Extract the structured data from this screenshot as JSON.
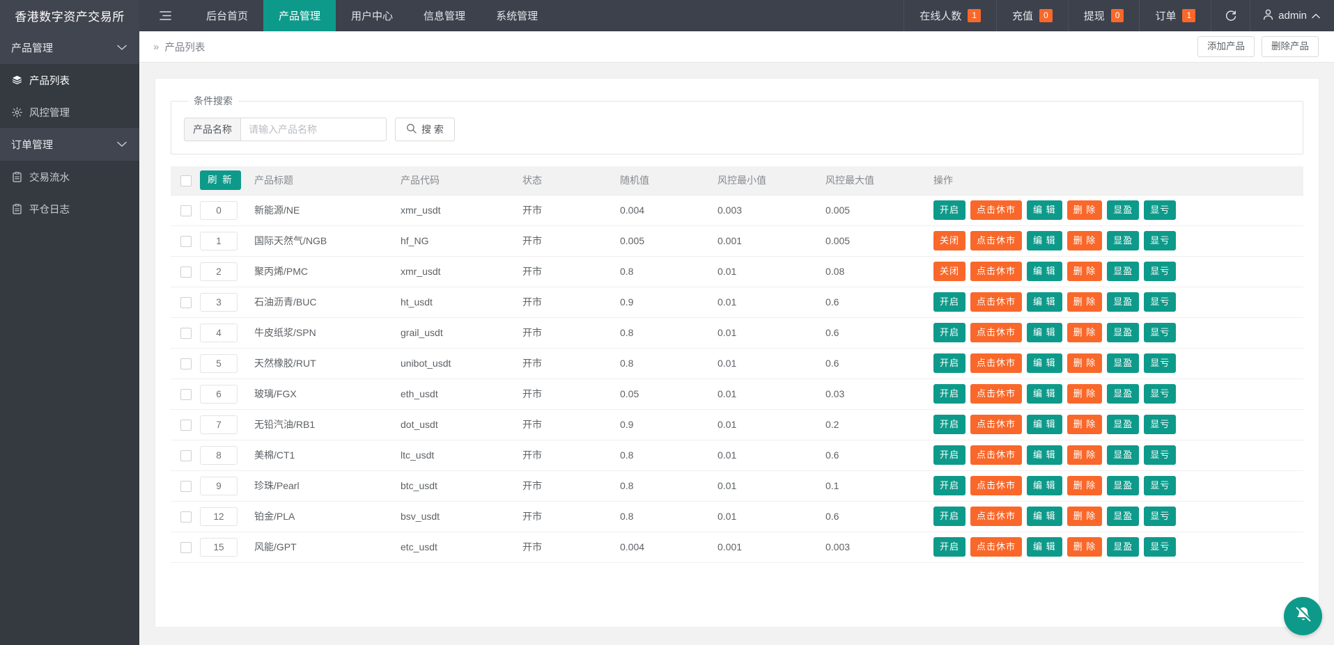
{
  "header": {
    "brand": "香港数字资产交易所",
    "hamburger_icon": "hamburger-icon",
    "nav": [
      {
        "label": "后台首页",
        "active": false
      },
      {
        "label": "产品管理",
        "active": true
      },
      {
        "label": "用户中心",
        "active": false
      },
      {
        "label": "信息管理",
        "active": false
      },
      {
        "label": "系统管理",
        "active": false
      }
    ],
    "stats": [
      {
        "label": "在线人数",
        "count": "1"
      },
      {
        "label": "充值",
        "count": "0"
      },
      {
        "label": "提现",
        "count": "0"
      },
      {
        "label": "订单",
        "count": "1"
      }
    ],
    "refresh_icon": "refresh-icon",
    "user_icon": "user-icon",
    "user_name": "admin",
    "user_caret_icon": "chevron-up-icon",
    "badge_color": "#F9682A",
    "accent_color": "#0E9A8A"
  },
  "sidebar": {
    "groups": [
      {
        "label": "产品管理",
        "caret_icon": "chevron-down-icon",
        "items": [
          {
            "label": "产品列表",
            "icon": "layers-icon",
            "active": true
          },
          {
            "label": "风控管理",
            "icon": "gear-icon",
            "active": false
          }
        ]
      },
      {
        "label": "订单管理",
        "caret_icon": "chevron-down-icon",
        "items": [
          {
            "label": "交易流水",
            "icon": "clipboard-icon",
            "active": false
          },
          {
            "label": "平仓日志",
            "icon": "clipboard-icon",
            "active": false
          }
        ]
      }
    ]
  },
  "breadcrumb": {
    "chevron": "»",
    "title": "产品列表",
    "actions": [
      {
        "label": "添加产品"
      },
      {
        "label": "删除产品"
      }
    ]
  },
  "search": {
    "legend": "条件搜索",
    "field_label": "产品名称",
    "placeholder": "请输入产品名称",
    "value": "",
    "button_label": "搜 索",
    "button_icon": "search-icon"
  },
  "table": {
    "refresh_label": "刷 新",
    "select_all_checked": false,
    "columns": [
      {
        "key": "checkbox",
        "label": ""
      },
      {
        "key": "refresh",
        "label": ""
      },
      {
        "key": "title",
        "label": "产品标题"
      },
      {
        "key": "code",
        "label": "产品代码"
      },
      {
        "key": "state",
        "label": "状态"
      },
      {
        "key": "random",
        "label": "随机值"
      },
      {
        "key": "min",
        "label": "风控最小值"
      },
      {
        "key": "max",
        "label": "风控最大值"
      },
      {
        "key": "ops",
        "label": "操作"
      }
    ],
    "op_labels": {
      "on": "开启",
      "off": "关闭",
      "close_market": "点击休市",
      "edit": "编 辑",
      "delete": "删 除",
      "profit": "显盈",
      "loss": "显亏"
    },
    "rows": [
      {
        "id": "0",
        "title": "新能源/NE",
        "code": "xmr_usdt",
        "state": "开市",
        "random": "0.004",
        "min": "0.003",
        "max": "0.005",
        "toggle": "开启"
      },
      {
        "id": "1",
        "title": "国际天然气/NGB",
        "code": "hf_NG",
        "state": "开市",
        "random": "0.005",
        "min": "0.001",
        "max": "0.005",
        "toggle": "关闭"
      },
      {
        "id": "2",
        "title": "聚丙烯/PMC",
        "code": "xmr_usdt",
        "state": "开市",
        "random": "0.8",
        "min": "0.01",
        "max": "0.08",
        "toggle": "关闭"
      },
      {
        "id": "3",
        "title": "石油沥青/BUC",
        "code": "ht_usdt",
        "state": "开市",
        "random": "0.9",
        "min": "0.01",
        "max": "0.6",
        "toggle": "开启"
      },
      {
        "id": "4",
        "title": "牛皮纸浆/SPN",
        "code": "grail_usdt",
        "state": "开市",
        "random": "0.8",
        "min": "0.01",
        "max": "0.6",
        "toggle": "开启"
      },
      {
        "id": "5",
        "title": "天然橡胶/RUT",
        "code": "unibot_usdt",
        "state": "开市",
        "random": "0.8",
        "min": "0.01",
        "max": "0.6",
        "toggle": "开启"
      },
      {
        "id": "6",
        "title": "玻璃/FGX",
        "code": "eth_usdt",
        "state": "开市",
        "random": "0.05",
        "min": "0.01",
        "max": "0.03",
        "toggle": "开启"
      },
      {
        "id": "7",
        "title": "无铅汽油/RB1",
        "code": "dot_usdt",
        "state": "开市",
        "random": "0.9",
        "min": "0.01",
        "max": "0.2",
        "toggle": "开启"
      },
      {
        "id": "8",
        "title": "美棉/CT1",
        "code": "ltc_usdt",
        "state": "开市",
        "random": "0.8",
        "min": "0.01",
        "max": "0.6",
        "toggle": "开启"
      },
      {
        "id": "9",
        "title": "珍珠/Pearl",
        "code": "btc_usdt",
        "state": "开市",
        "random": "0.8",
        "min": "0.01",
        "max": "0.1",
        "toggle": "开启"
      },
      {
        "id": "12",
        "title": "铂金/PLA",
        "code": "bsv_usdt",
        "state": "开市",
        "random": "0.8",
        "min": "0.01",
        "max": "0.6",
        "toggle": "开启"
      },
      {
        "id": "15",
        "title": "风能/GPT",
        "code": "etc_usdt",
        "state": "开市",
        "random": "0.004",
        "min": "0.001",
        "max": "0.003",
        "toggle": "开启"
      }
    ]
  },
  "fab": {
    "icon": "bell-muted-icon",
    "color": "#0E9A8A"
  }
}
